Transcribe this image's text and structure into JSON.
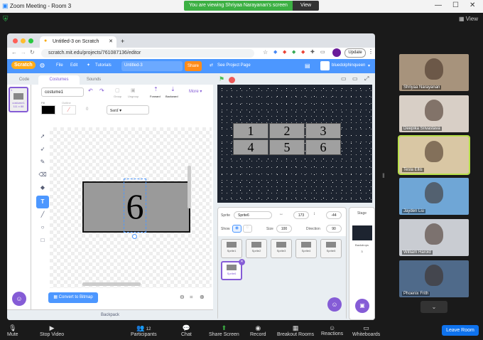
{
  "zoom": {
    "title": "Zoom Meeting - Room 3",
    "banner_text": "You are viewing Shriyaa Narayanan's screen",
    "view_options": "View Options",
    "view_label": "View",
    "leave_label": "Leave Room",
    "toolbar": [
      "Mute",
      "Stop Video",
      "Participants",
      "Chat",
      "Share Screen",
      "Record",
      "Breakout Rooms",
      "Reactions",
      "Whiteboards"
    ],
    "participants_count": "12",
    "participants": [
      {
        "name": "Shriyaa Narayanan",
        "color": "#a7937c"
      },
      {
        "name": "Deepika Srivastava",
        "color": "#d8cfc6"
      },
      {
        "name": "Tesla Ellis",
        "color": "#d9c7a4"
      },
      {
        "name": "Jayden Liu",
        "color": "#6fa6d6"
      },
      {
        "name": "William Harold",
        "color": "#c9ccd2"
      },
      {
        "name": "Phoenix Frith",
        "color": "#4f6a8a"
      }
    ]
  },
  "browser": {
    "tab_title": "Untitled-3 on Scratch",
    "url": "scratch.mit.edu/projects/761087136/editor",
    "update_label": "Update"
  },
  "scratch": {
    "menu": [
      "File",
      "Edit",
      "Tutorials"
    ],
    "title": "Untitled-3",
    "share": "Share",
    "see_project": "See Project Page",
    "user": "bluedolphinqueen",
    "tabs": {
      "code": "Code",
      "costumes": "Costumes",
      "sounds": "Sounds"
    },
    "costume_name": "costume1",
    "costume_thumb_label": "costume1",
    "costume_size": "111 x 88",
    "costume_number": "1",
    "paint": {
      "fill_label": "Fill",
      "outline_label": "Outline",
      "outline_value": "0",
      "font": "Serif",
      "group": "Group",
      "ungroup": "Ungroup",
      "forward": "Forward",
      "backward": "Backward",
      "more": "More",
      "convert": "Convert to Bitmap",
      "big_number": "6"
    },
    "backpack": "Backpack",
    "stage_numbers": [
      "1",
      "2",
      "3",
      "4",
      "5",
      "6"
    ],
    "sprite_info": {
      "sprite_label": "Sprite",
      "sprite_name": "Sprite6",
      "x_value": "173",
      "y_value": "-44",
      "show_label": "Show",
      "size_label": "Size",
      "size_value": "100",
      "direction_label": "Direction",
      "direction_value": "90"
    },
    "sprites": [
      "Sprite1",
      "Sprite2",
      "Sprite3",
      "Sprite4",
      "Sprite5",
      "Sprite6"
    ],
    "stage_label": "Stage",
    "backdrops_label": "Backdrops",
    "backdrops_count": "3"
  }
}
